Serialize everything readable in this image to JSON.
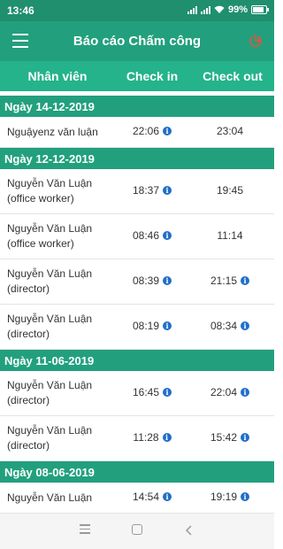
{
  "status_bar": {
    "time": "13:46",
    "battery": "99%"
  },
  "app_bar": {
    "title": "Báo cáo Chấm công"
  },
  "columns": {
    "employee": "Nhân viên",
    "check_in": "Check in",
    "check_out": "Check out"
  },
  "groups": [
    {
      "date": "Ngày 14-12-2019",
      "rows": [
        {
          "name": "Nguậyenz văn luận",
          "check_in": "22:06",
          "check_out": "23:04",
          "in_info": true,
          "out_info": false
        }
      ]
    },
    {
      "date": "Ngày 12-12-2019",
      "rows": [
        {
          "name": "Nguyễn Văn Luận (office worker)",
          "check_in": "18:37",
          "check_out": "19:45",
          "in_info": true,
          "out_info": false
        },
        {
          "name": "Nguyễn Văn Luận (office worker)",
          "check_in": "08:46",
          "check_out": "11:14",
          "in_info": true,
          "out_info": false
        },
        {
          "name": "Nguyễn Văn Luận (director)",
          "check_in": "08:39",
          "check_out": "21:15",
          "in_info": true,
          "out_info": true
        },
        {
          "name": "Nguyễn Văn Luận (director)",
          "check_in": "08:19",
          "check_out": "08:34",
          "in_info": true,
          "out_info": true
        }
      ]
    },
    {
      "date": "Ngày 11-06-2019",
      "rows": [
        {
          "name": "Nguyễn Văn Luận (director)",
          "check_in": "16:45",
          "check_out": "22:04",
          "in_info": true,
          "out_info": true
        },
        {
          "name": "Nguyễn Văn Luận (director)",
          "check_in": "11:28",
          "check_out": "15:42",
          "in_info": true,
          "out_info": true
        }
      ]
    },
    {
      "date": "Ngày 08-06-2019",
      "rows": [
        {
          "name": "Nguyễn Văn Luận",
          "check_in": "14:54",
          "check_out": "19:19",
          "in_info": true,
          "out_info": true
        }
      ]
    }
  ],
  "icons": {
    "menu": "hamburger-menu-icon",
    "logout": "power-logout-icon",
    "info": "info-icon",
    "info_glyph": "i"
  },
  "colors": {
    "primary": "#22a07d",
    "header": "#24b38b",
    "status_bar": "#1f8f6e",
    "logout_icon": "#e5533d",
    "info_icon": "#1e6fc8"
  }
}
